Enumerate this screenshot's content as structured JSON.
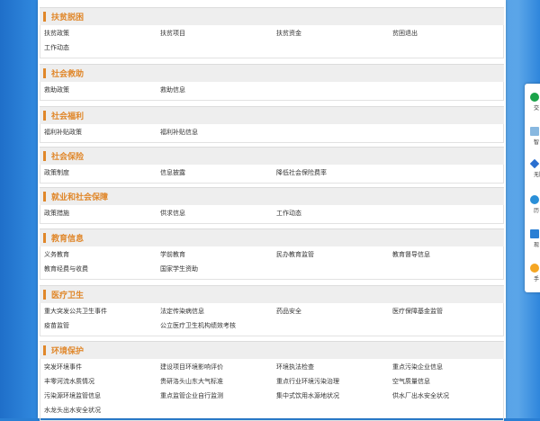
{
  "sections": [
    {
      "title": "扶贫脱困",
      "items": [
        "扶贫政策",
        "扶贫项目",
        "扶贫资金",
        "贫困退出",
        "工作动态"
      ]
    },
    {
      "title": "社会救助",
      "items": [
        "救助政策",
        "救助信息"
      ]
    },
    {
      "title": "社会福利",
      "items": [
        "福利补贴政策",
        "福利补贴信息"
      ]
    },
    {
      "title": "社会保险",
      "items": [
        "政策制度",
        "信息披露",
        "降低社会保险费率"
      ]
    },
    {
      "title": "就业和社会保障",
      "items": [
        "政策措施",
        "供求信息",
        "工作动态"
      ]
    },
    {
      "title": "教育信息",
      "items": [
        "义务教育",
        "学前教育",
        "民办教育监管",
        "教育督导信息",
        "教育经费与收费",
        "国家学生资助"
      ]
    },
    {
      "title": "医疗卫生",
      "items": [
        "重大突发公共卫生事件",
        "法定传染病信息",
        "药品安全",
        "医疗保障基金监管",
        "疫苗监管",
        "公立医疗卫生机构绩效考核"
      ]
    },
    {
      "title": "环境保护",
      "items": [
        "突发环境事件",
        "建设项目环境影响评价",
        "环境执法检查",
        "重点污染企业信息",
        "丰零河流水质情况",
        "贵研洛头山东大气标准",
        "重点行业环境污染治理",
        "空气质量信息",
        "污染源环境监管信息",
        "重点监管企业自行监测",
        "集中式饮用水源地状况",
        "供水厂出水安全状况",
        "水龙头出水安全状况"
      ]
    }
  ],
  "right_panel": [
    {
      "icon": "green-dot-icon",
      "color": "#1aa34a",
      "label": "交"
    },
    {
      "icon": "doc-icon",
      "color": "#88b8e0",
      "label": "智"
    },
    {
      "icon": "diamond-icon",
      "color": "#2a6fd0",
      "label": "无障"
    },
    {
      "icon": "circle-icon",
      "color": "#2a8fd8",
      "label": "历"
    },
    {
      "icon": "mobile-icon",
      "color": "#2a7fd4",
      "label": "现"
    },
    {
      "icon": "sun-icon",
      "color": "#f5a623",
      "label": "手"
    }
  ]
}
